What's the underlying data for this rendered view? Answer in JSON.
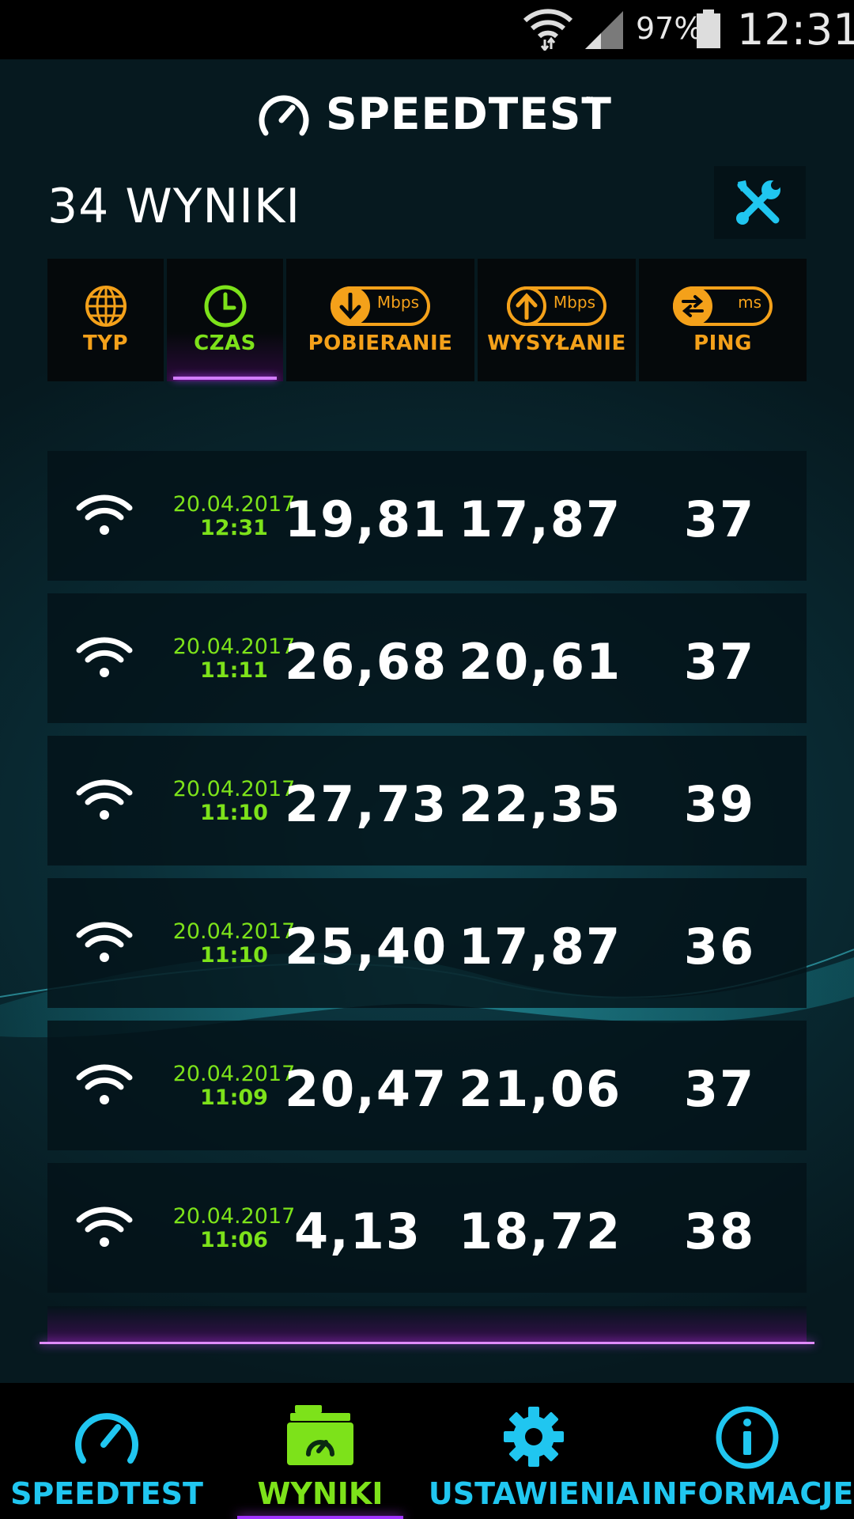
{
  "status_bar": {
    "battery_percent": "97%",
    "clock": "12:31",
    "icons": [
      "wifi-icon",
      "cell-signal-icon",
      "battery-icon"
    ]
  },
  "header": {
    "brand": "SPEEDTEST",
    "trademark": "™",
    "results_title": "34 WYNIKI",
    "tools_icon": "tools-icon"
  },
  "sort_columns": [
    {
      "key": "type",
      "label": "TYP",
      "icon": "globe-icon"
    },
    {
      "key": "time",
      "label": "CZAS",
      "icon": "clock-icon",
      "active": true
    },
    {
      "key": "download",
      "label": "POBIERANIE",
      "icon": "download-icon",
      "unit": "Mbps"
    },
    {
      "key": "upload",
      "label": "WYSYŁANIE",
      "icon": "upload-icon",
      "unit": "Mbps"
    },
    {
      "key": "ping",
      "label": "PING",
      "icon": "ping-icon",
      "unit": "ms"
    }
  ],
  "results": [
    {
      "type": "wifi",
      "date": "20.04.2017",
      "time": "12:31",
      "download": "19,81",
      "upload": "17,87",
      "ping": "37"
    },
    {
      "type": "wifi",
      "date": "20.04.2017",
      "time": "11:11",
      "download": "26,68",
      "upload": "20,61",
      "ping": "37"
    },
    {
      "type": "wifi",
      "date": "20.04.2017",
      "time": "11:10",
      "download": "27,73",
      "upload": "22,35",
      "ping": "39"
    },
    {
      "type": "wifi",
      "date": "20.04.2017",
      "time": "11:10",
      "download": "25,40",
      "upload": "17,87",
      "ping": "36"
    },
    {
      "type": "wifi",
      "date": "20.04.2017",
      "time": "11:09",
      "download": "20,47",
      "upload": "21,06",
      "ping": "37"
    },
    {
      "type": "wifi",
      "date": "20.04.2017",
      "time": "11:06",
      "download": "4,13",
      "upload": "18,72",
      "ping": "38"
    }
  ],
  "bottom_nav": [
    {
      "label": "SPEEDTEST",
      "icon": "speedometer-icon"
    },
    {
      "label": "WYNIKI",
      "icon": "results-folder-icon",
      "active": true
    },
    {
      "label": "USTAWIENIA",
      "icon": "gear-icon"
    },
    {
      "label": "INFORMACJE",
      "icon": "info-icon"
    }
  ],
  "colors": {
    "accent_orange": "#f4a11a",
    "accent_green": "#7de21a",
    "accent_cyan": "#20c6f0",
    "accent_purple": "#b53cff"
  }
}
